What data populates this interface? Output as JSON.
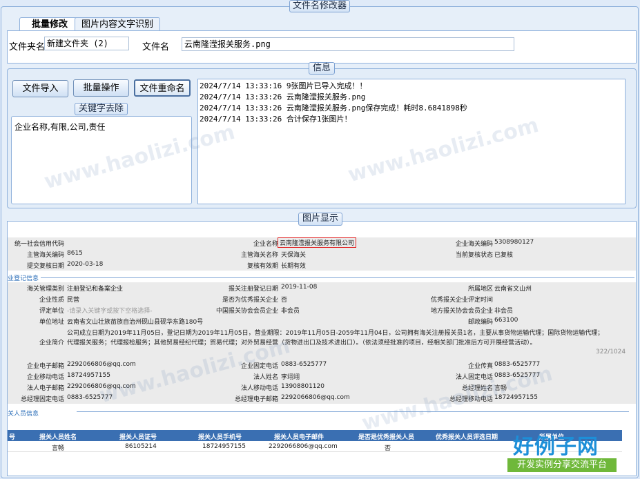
{
  "window": {
    "title": "文件名修改器"
  },
  "tabs": [
    {
      "label": "批量修改"
    },
    {
      "label": "图片内容文字识别"
    }
  ],
  "folder": {
    "label": "文件夹名",
    "value": "新建文件夹 (2)"
  },
  "file": {
    "label": "文件名",
    "value": "云南隆滢报关服务.png"
  },
  "info": {
    "title": "信息"
  },
  "buttons": {
    "import": "文件导入",
    "batch": "批量操作",
    "rename": "文件重命名"
  },
  "keywords": {
    "title": "关键字去除",
    "value": "企业名称,有限,公司,责任"
  },
  "log": [
    "2024/7/14 13:33:16  9张图片已导入完成！！",
    "2024/7/14 13:33:26  云南隆滢报关服务.png",
    "2024/7/14 13:33:26  云南隆滢报关服务.png保存完成！耗时8.6841898秒",
    "2024/7/14 13:33:26  合计保存1张图片！"
  ],
  "image_panel": {
    "title": "图片显示"
  },
  "doc": {
    "r1": [
      "统一社会信用代码",
      "",
      "企业名称",
      "云南隆滢报关服务有限公司",
      "企业海关编码",
      "5308980127"
    ],
    "r2": [
      "主管海关编码",
      "8615",
      "主管海关名称",
      "天保海关",
      "当前复核状态",
      "已复核"
    ],
    "r3": [
      "提交复核日期",
      "2020-03-18",
      "复核有效期",
      "长期有效"
    ],
    "sect1": "业登记信息",
    "r4": [
      "海关管理类别",
      "注册登记和备案企业",
      "报关注册登记日期",
      "2019-11-08",
      "所属地区",
      "云南省文山州"
    ],
    "r5": [
      "企业性质",
      "民营",
      "是否为优秀报关企业",
      "否",
      "优秀报关企业评定时间",
      ""
    ],
    "r6": [
      "评定单位",
      "-请录入关键字或按下空格选择-",
      "中国报关协会会员企业",
      "非会员",
      "地方报关协会会员企业",
      "非会员"
    ],
    "r7": [
      "单位地址",
      "云南省文山壮族苗族自治州砚山县砚华东路180号",
      "邮政编码",
      "663100"
    ],
    "r8_label": "企业简介",
    "r8_text1": "公司成立日期为2019年11月05日，登记日期为2019年11月05日，营业期限：2019年11月05日-2059年11月04日，公司拥有海关注册报关员1名，主要从事货物运输代理；国际货物运输代理；",
    "r8_text2": "代理报关服务；代理报检服务；其他贸易经纪代理；贸易代理；对外贸易经营（货物进出口及技术进出口）。（依法须经批准的项目，经相关部门批准后方可开展经营活动）。",
    "r8_count": "322/1024",
    "r9": [
      "企业电子邮箱",
      "2292066806@qq.com",
      "企业固定电话",
      "0883-6525777",
      "企业传真",
      "0883-6525777"
    ],
    "r10": [
      "企业移动电话",
      "18724957155",
      "法人姓名",
      "李翊翊",
      "法人固定电话",
      "0883-6525777"
    ],
    "r11": [
      "法人电子邮箱",
      "2292066806@qq.com",
      "法人移动电话",
      "13908801120",
      "总经理姓名",
      "言畅"
    ],
    "r12": [
      "总经理固定电话",
      "0883-6525777",
      "总经理电子邮箱",
      "2292066806@qq.com",
      "总经理移动电话",
      "18724957155"
    ],
    "sect2": "关人员信息",
    "table_head": [
      "号",
      "报关人员姓名",
      "报关人员证号",
      "报关人员手机号",
      "报关人员电子邮件",
      "是否是优秀报关人员",
      "优秀报关人员评选日期",
      "所属单位"
    ],
    "table_row": [
      "",
      "言畅",
      "86105214",
      "18724957155",
      "2292066806@qq.com",
      "否",
      "",
      ""
    ]
  },
  "watermark": "www.haolizi.com",
  "logo": {
    "title": "好例子网",
    "slogan": "开发实例分享交流平台"
  }
}
